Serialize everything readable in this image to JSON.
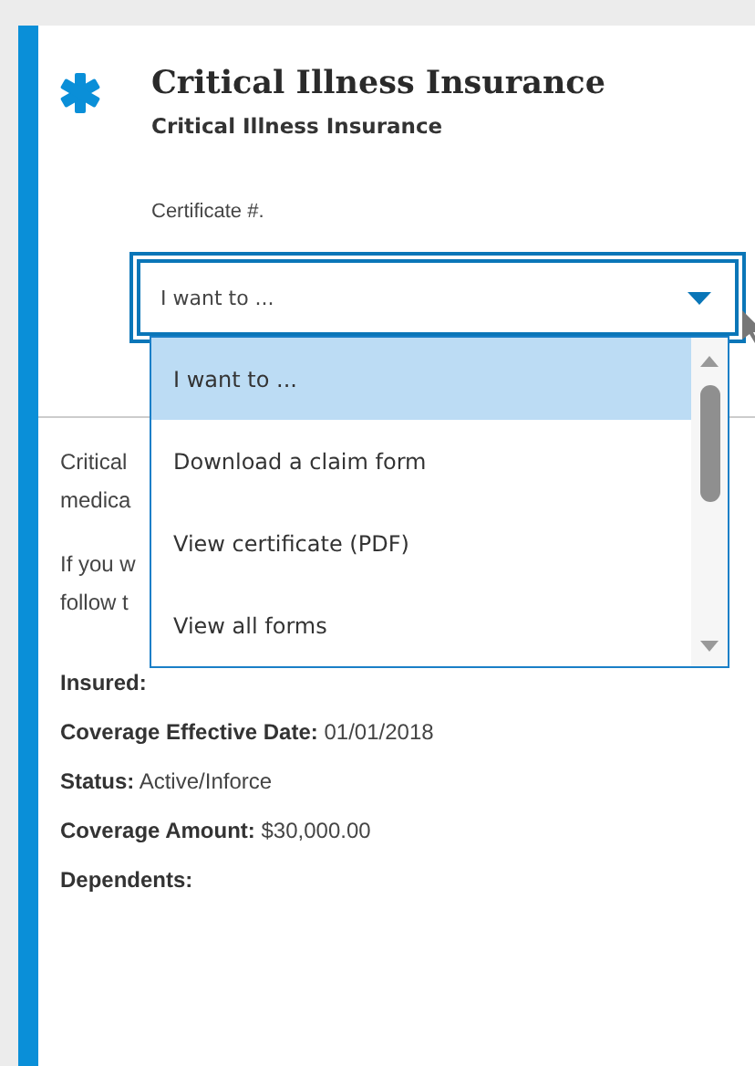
{
  "title": "Critical Illness Insurance",
  "subtitle": "Critical Illness Insurance",
  "certificate_label": "Certificate #.",
  "select": {
    "value": "I want to ...",
    "expanded": true,
    "options": [
      {
        "label": "I want to ...",
        "selected": true
      },
      {
        "label": "Download a claim form",
        "selected": false
      },
      {
        "label": "View certificate (PDF)",
        "selected": false
      },
      {
        "label": "View all forms",
        "selected": false
      }
    ]
  },
  "paragraphs": [
    [
      "Critical",
      "medica"
    ],
    [
      "If you w",
      "follow t"
    ]
  ],
  "details": [
    {
      "label": "Insured:"
    },
    {
      "label": "Coverage Effective Date:",
      "value": "01/01/2018"
    },
    {
      "label": "Status:",
      "value": "Active/Inforce"
    },
    {
      "label": "Coverage Amount:",
      "value": "$30,000.00"
    },
    {
      "label": "Dependents:"
    }
  ]
}
